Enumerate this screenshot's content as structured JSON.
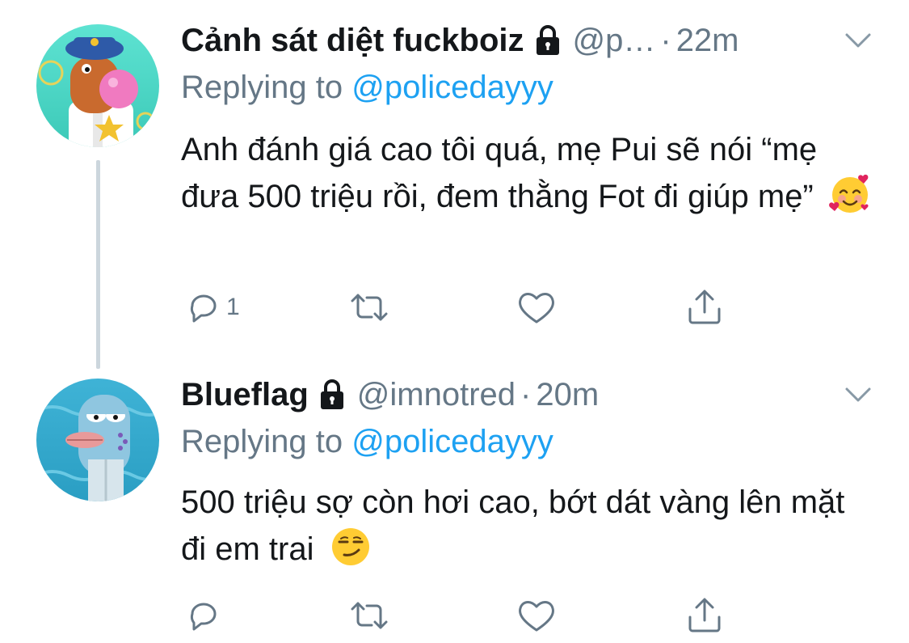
{
  "colors": {
    "accent": "#1da1f2",
    "secondary_text": "#657786",
    "primary_text": "#14171a",
    "thread_line": "#ccd6dd"
  },
  "tweets": [
    {
      "display_name": "Cảnh sát diệt fuckboiz",
      "locked_icon": "lock-icon",
      "handle": "@p…",
      "separator": "·",
      "time": "22m",
      "replying_prefix": "Replying to",
      "replying_to": "@policedayyy",
      "text": "Anh đánh giá cao tôi quá, mẹ Pui sẽ nói “mẹ đưa 500 triệu rồi, đem thằng Fot đi giúp mẹ”",
      "emoji": "smiling-face-with-hearts",
      "reply_count": "1",
      "avatar": "police-officer-cartoon-avatar"
    },
    {
      "display_name": "Blueflag",
      "locked_icon": "lock-icon",
      "handle": "@imnotred",
      "separator": "·",
      "time": "20m",
      "replying_prefix": "Replying to",
      "replying_to": "@policedayyy",
      "text": "500 triệu sợ còn hơi cao, bớt dát vàng lên mặt đi em trai",
      "emoji": "smirking-face",
      "reply_count": "",
      "avatar": "blue-fish-cartoon-avatar"
    }
  ]
}
